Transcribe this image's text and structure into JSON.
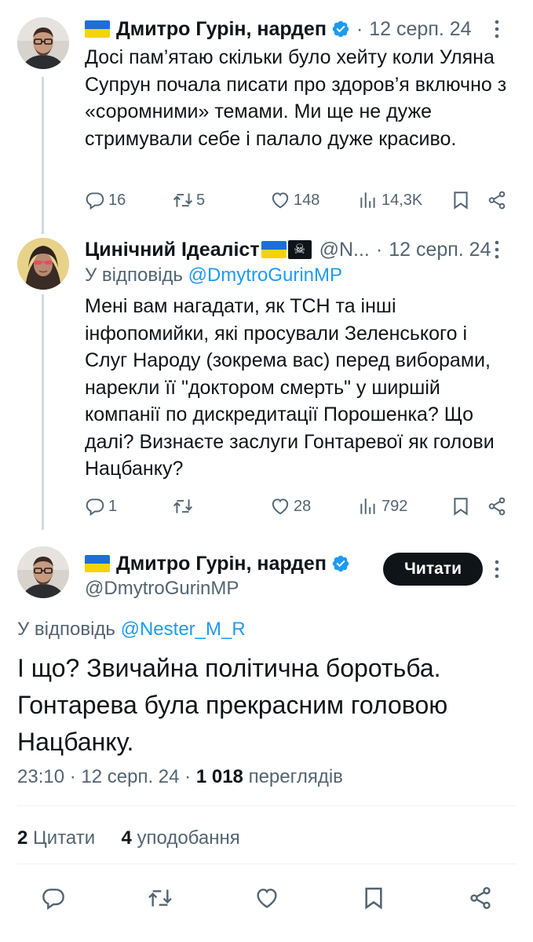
{
  "tweets": [
    {
      "name": "Дмитро Гурін, нардеп",
      "date": "12 серп. 24",
      "text": "Досі пам’ятаю скільки було хейту коли Уляна Супрун почала писати про здоров’я включно з «соромними» темами. Ми ще не дуже стримували себе і палало дуже красиво.",
      "replies": "16",
      "reposts": "5",
      "likes": "148",
      "views": "14,3K"
    },
    {
      "name": "Цинічний Ідеаліст",
      "handle": "@N...",
      "date": "12 серп. 24",
      "reply_prefix": "У відповідь",
      "reply_handle": "@DmytroGurinMP",
      "text": "Мені вам нагадати, як ТСН та інші інфопомийки, які просували Зеленського і Слуг Народу (зокрема вас) перед виборами, нарекли її \"доктором смерть\" у ширшій компанії по дискредитації Порошенка? Що далі? Визнаєте заслуги Гонтаревої як голови Нацбанку?",
      "replies": "1",
      "reposts": "",
      "likes": "28",
      "views": "792"
    }
  ],
  "main": {
    "name": "Дмитро Гурін, нардеп",
    "handle": "@DmytroGurinMP",
    "read_button": "Читати",
    "reply_prefix": "У відповідь",
    "reply_handle": "@Nester_M_R",
    "text": "І що? Звичайна політична боротьба. Гонтарева була прекрасним головою Нацбанку.",
    "time": "23:10",
    "date": "12 серп. 24",
    "views_count": "1 018",
    "views_label": "переглядів",
    "quotes_count": "2",
    "quotes_label": "Цитати",
    "likes_count": "4",
    "likes_label": "уподобання"
  },
  "colors": {
    "accent": "#1d9bf0",
    "text": "#0f1419",
    "secondary": "#536471",
    "flag_blue": "#1d6fd6",
    "flag_yellow": "#f5d30b"
  },
  "icons": [
    "reply-icon",
    "repost-icon",
    "like-icon",
    "views-icon",
    "bookmark-icon",
    "share-icon",
    "more-icon",
    "verified-icon",
    "pirate-flag-icon"
  ]
}
